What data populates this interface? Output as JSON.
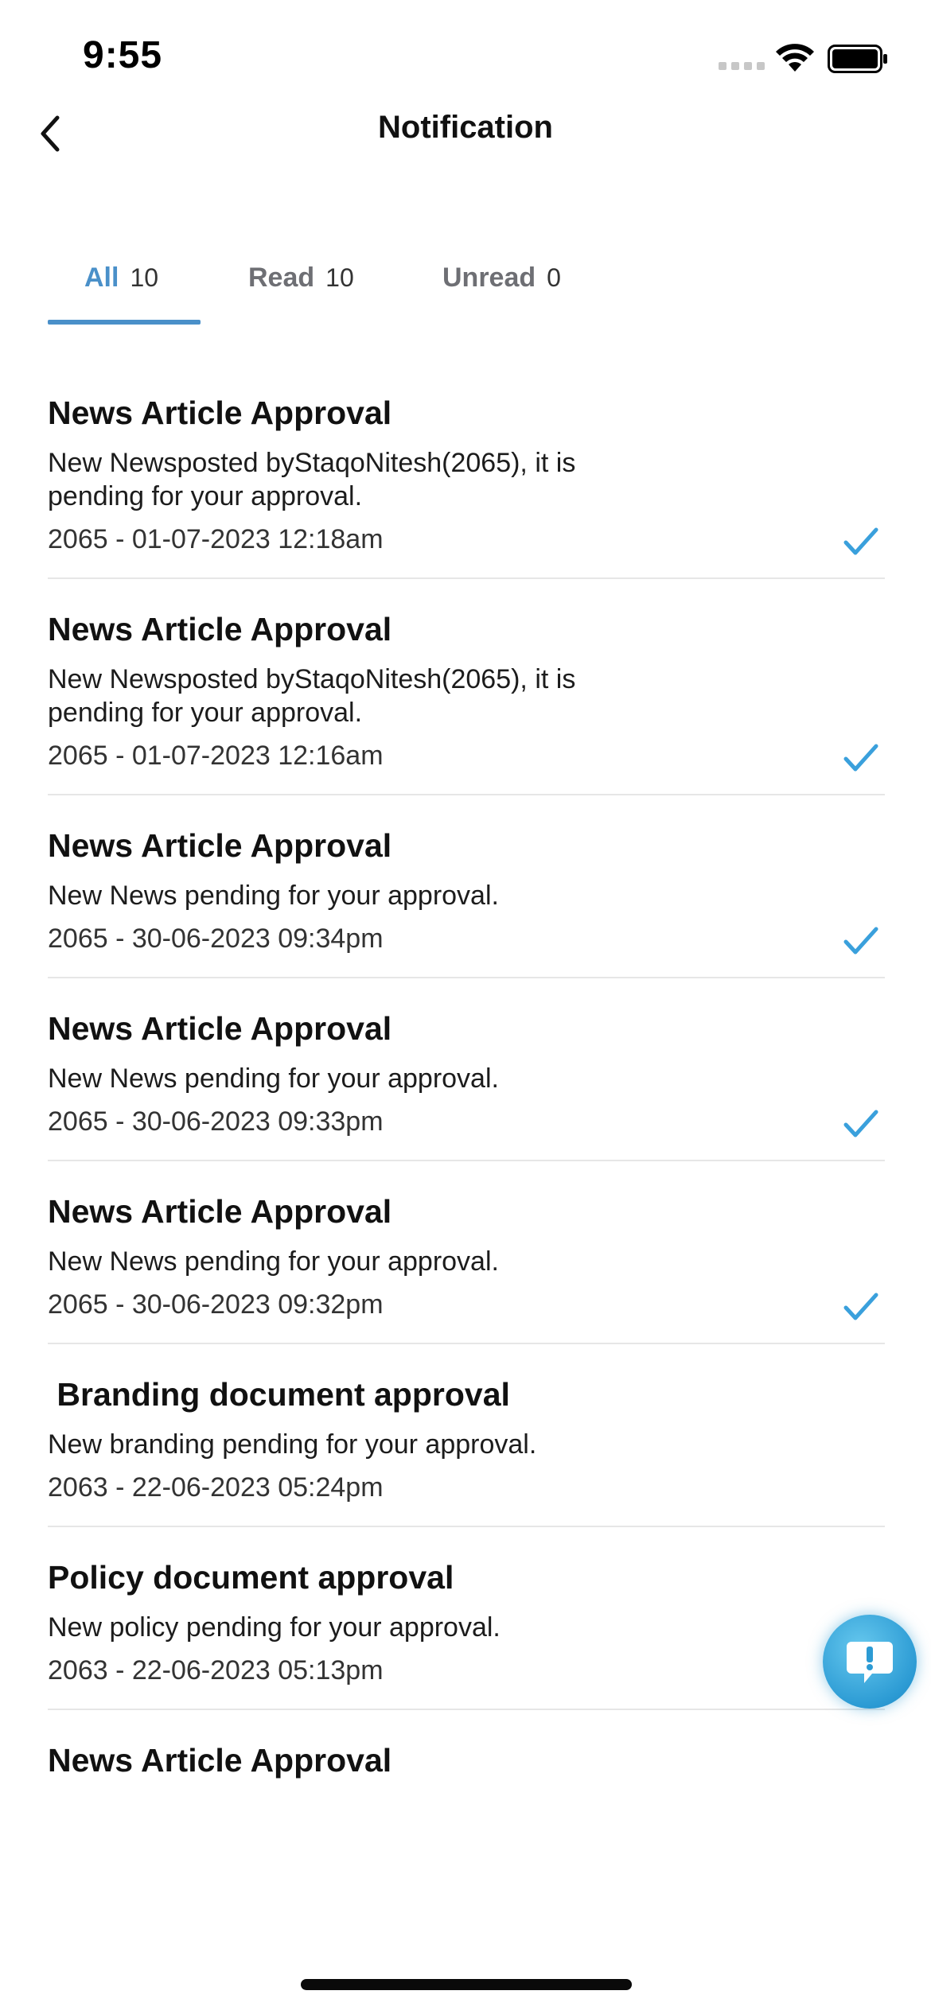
{
  "status_bar": {
    "time": "9:55"
  },
  "header": {
    "title": "Notification"
  },
  "tabs": [
    {
      "label": "All",
      "count": "10"
    },
    {
      "label": "Read",
      "count": "10"
    },
    {
      "label": "Unread",
      "count": "0"
    }
  ],
  "notifications": [
    {
      "title": "News Article Approval",
      "body": "New Newsposted byStaqoNitesh(2065), it is pending for your approval.",
      "meta": "2065 -  01-07-2023 12:18am",
      "read": true
    },
    {
      "title": "News Article Approval",
      "body": "New Newsposted byStaqoNitesh(2065), it is pending for your approval.",
      "meta": "2065 -  01-07-2023 12:16am",
      "read": true
    },
    {
      "title": "News Article Approval",
      "body": "New News pending for your approval.",
      "meta": "2065 -  30-06-2023 09:34pm",
      "read": true
    },
    {
      "title": "News Article Approval",
      "body": "New News pending for your approval.",
      "meta": "2065 -  30-06-2023 09:33pm",
      "read": true
    },
    {
      "title": "News Article Approval",
      "body": "New News pending for your approval.",
      "meta": "2065 -  30-06-2023 09:32pm",
      "read": true
    },
    {
      "title": " Branding document approval",
      "body": "New branding pending for your approval.",
      "meta": "2063 -  22-06-2023 05:24pm",
      "read": true
    },
    {
      "title": "Policy document approval",
      "body": "New policy pending for your approval.",
      "meta": "2063 -  22-06-2023 05:13pm",
      "read": true
    },
    {
      "title": "News Article Approval"
    }
  ],
  "colors": {
    "accent": "#4a90c9",
    "check": "#3aa0dc",
    "divider": "#e6e6e6"
  },
  "icons": {
    "back": "chevron-left-icon",
    "check": "checkmark-icon",
    "help": "exclamation-bubble-icon",
    "wifi": "wifi-icon",
    "battery": "battery-icon"
  }
}
